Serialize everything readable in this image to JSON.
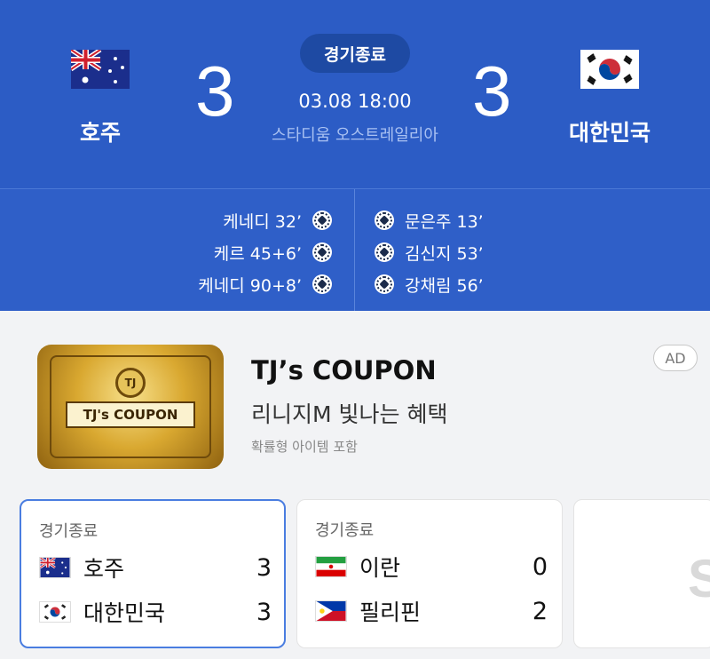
{
  "match": {
    "status": "경기종료",
    "datetime": "03.08 18:00",
    "stadium": "스타디움 오스트레일리아",
    "home": {
      "name": "호주",
      "score": "3",
      "flag": "australia-flag"
    },
    "away": {
      "name": "대한민국",
      "score": "3",
      "flag": "south-korea-flag"
    }
  },
  "scorers": {
    "home": [
      "케네디 32’",
      "케르 45+6’",
      "케네디 90+8’"
    ],
    "away": [
      "문은주 13’",
      "김신지 53’",
      "강채림 56’"
    ]
  },
  "ad": {
    "image_label": "TJ's COUPON",
    "medal": "TJ",
    "title": "TJ’s COUPON",
    "subtitle": "리니지M 빛나는 혜택",
    "note": "확률형 아이템 포함",
    "badge": "AD"
  },
  "other_matches": [
    {
      "status": "경기종료",
      "teams": [
        {
          "name": "호주",
          "score": "3",
          "flag": "australia-flag"
        },
        {
          "name": "대한민국",
          "score": "3",
          "flag": "south-korea-flag"
        }
      ]
    },
    {
      "status": "경기종료",
      "teams": [
        {
          "name": "이란",
          "score": "0",
          "flag": "iran-flag"
        },
        {
          "name": "필리핀",
          "score": "2",
          "flag": "philippines-flag"
        }
      ]
    }
  ],
  "colors": {
    "header_blue": "#2c5cc5",
    "status_pill": "#1e4aa3",
    "active_card_border": "#4a7de0"
  }
}
